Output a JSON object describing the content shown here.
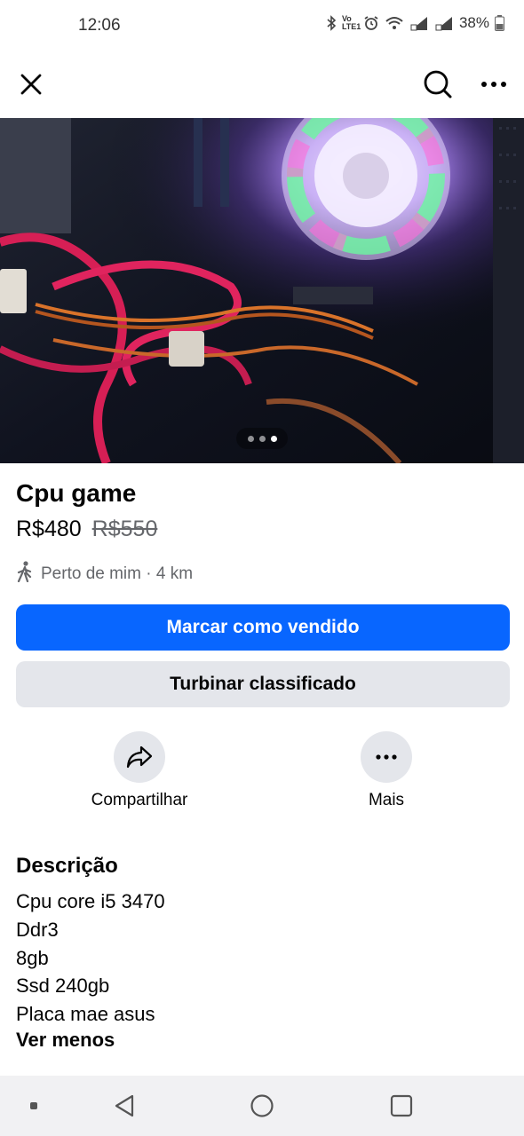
{
  "status_bar": {
    "time": "12:06",
    "battery": "38%",
    "volte_label": "Vo LTE1",
    "icons": [
      "bluetooth-icon",
      "volte-icon",
      "alarm-icon",
      "wifi-icon",
      "signal-icon",
      "signal-icon",
      "battery-icon"
    ]
  },
  "top_bar": {
    "close_icon": "close-icon",
    "search_icon": "search-icon",
    "more_icon": "more-horizontal-icon"
  },
  "photo": {
    "description_icon": "product-photo",
    "carousel": {
      "count": 3,
      "active_index": 2
    }
  },
  "listing": {
    "title": "Cpu game",
    "price": "R$480",
    "old_price": "R$550",
    "location": "Perto de mim · 4 km",
    "location_icon": "walking-person-icon"
  },
  "buttons": {
    "mark_sold": "Marcar como vendido",
    "boost": "Turbinar classificado"
  },
  "actions": [
    {
      "label": "Compartilhar",
      "icon": "share-icon"
    },
    {
      "label": "Mais",
      "icon": "more-horizontal-icon"
    }
  ],
  "description": {
    "heading": "Descrição",
    "lines": [
      "Cpu core i5 3470",
      "Ddr3",
      "8gb",
      "Ssd 240gb",
      "Placa mae asus"
    ],
    "see_less": "Ver menos"
  },
  "colors": {
    "primary": "#0866ff",
    "secondary_bg": "#e4e6eb",
    "muted_text": "#65676b"
  },
  "nav_bar": {
    "icons": [
      "recent-dot-icon",
      "back-icon",
      "home-icon",
      "recents-icon"
    ]
  }
}
